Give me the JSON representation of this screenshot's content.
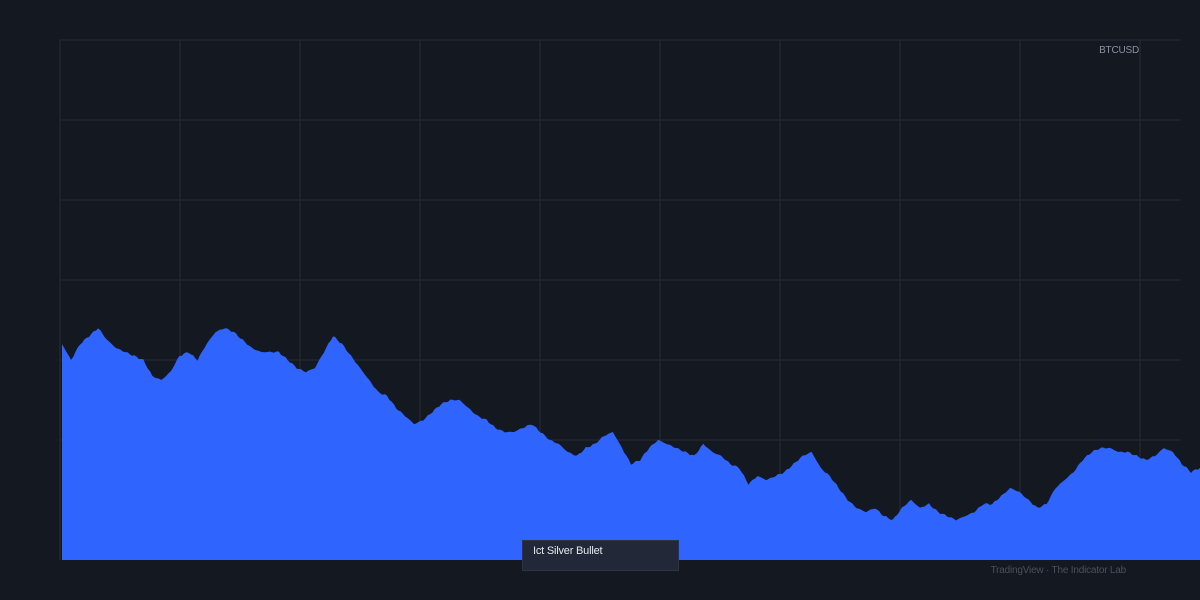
{
  "chart_data": {
    "type": "area",
    "series": [
      {
        "values": [
          54,
          50,
          54,
          56,
          58,
          55,
          53,
          52,
          51,
          50,
          46,
          45,
          47,
          51,
          52,
          50,
          54,
          57,
          58,
          57,
          55,
          53,
          52,
          52,
          52,
          50,
          48,
          47,
          48,
          52,
          56,
          54,
          51,
          48,
          45,
          42,
          41,
          38,
          36,
          34,
          35,
          37,
          39,
          40,
          40,
          38,
          36,
          35,
          33,
          32,
          32,
          33,
          34,
          32,
          30,
          29,
          27,
          26,
          28,
          29,
          31,
          32,
          28,
          24,
          25,
          28,
          30,
          29,
          28,
          27,
          26,
          29,
          27,
          26,
          24,
          23,
          19,
          21,
          20,
          21,
          22,
          24,
          26,
          27,
          23,
          21,
          18,
          15,
          13,
          12,
          13,
          11,
          10,
          13,
          15,
          13,
          14,
          12,
          11,
          10,
          11,
          12,
          14,
          14,
          16,
          18,
          17,
          15,
          13,
          14,
          18,
          20,
          22,
          25,
          27,
          28,
          28,
          27,
          27,
          26,
          25,
          26,
          28,
          27,
          24,
          22,
          23
        ]
      }
    ],
    "ylim": [
      0,
      130
    ],
    "grid": true,
    "symbol": "BTCUSD"
  },
  "indicator": {
    "name": "Ict Silver Bullet"
  },
  "footer": {
    "attribution": "TradingView · The Indicator Lab"
  },
  "colors": {
    "background": "#141821",
    "area": "#2f64ff",
    "grid": "#262b36"
  }
}
